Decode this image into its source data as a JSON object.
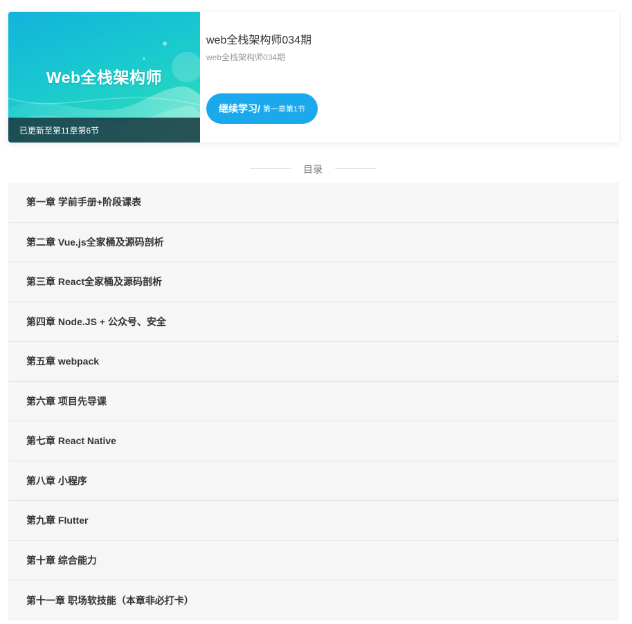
{
  "course": {
    "cover_title": "Web全栈架构师",
    "cover_update_text": "已更新至第11章第6节",
    "title": "web全栈架构师034期",
    "subtitle": "web全栈架构师034期",
    "continue_label": "继续学习/",
    "continue_progress": "第一章第1节",
    "accent_color": "#1aa9ec"
  },
  "catalog": {
    "title": "目录",
    "chapters": [
      {
        "label": "第一章 学前手册+阶段课表"
      },
      {
        "label": "第二章 Vue.js全家桶及源码剖析"
      },
      {
        "label": "第三章 React全家桶及源码剖析"
      },
      {
        "label": "第四章 Node.JS + 公众号、安全"
      },
      {
        "label": "第五章 webpack"
      },
      {
        "label": "第六章 项目先导课"
      },
      {
        "label": "第七章 React Native"
      },
      {
        "label": "第八章 小程序"
      },
      {
        "label": "第九章 Flutter"
      },
      {
        "label": "第十章 综合能力"
      },
      {
        "label": "第十一章 职场软技能（本章非必打卡）"
      }
    ]
  }
}
